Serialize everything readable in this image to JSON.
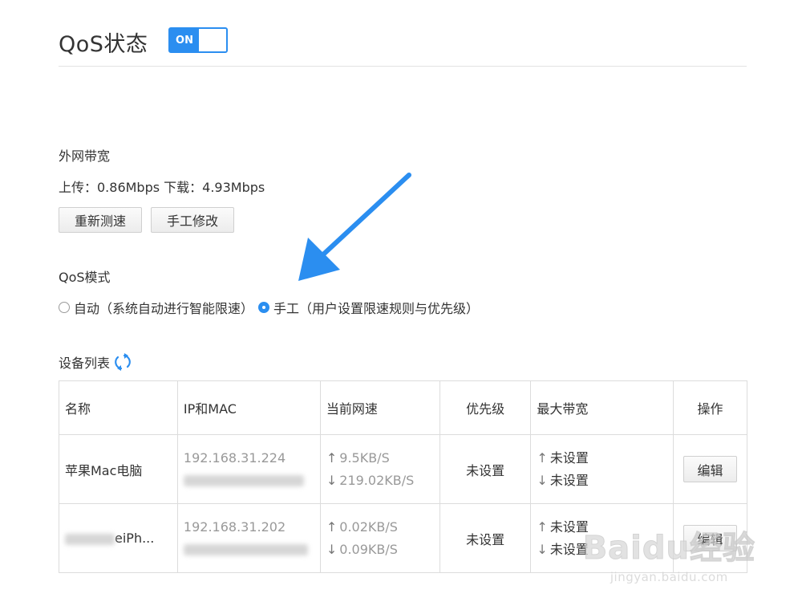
{
  "header": {
    "title": "QoS状态",
    "toggle_label": "ON",
    "toggle_state": "on"
  },
  "bandwidth": {
    "section_title": "外网带宽",
    "summary": "上传：0.86Mbps 下载：4.93Mbps",
    "retest_button": "重新测速",
    "manual_button": "手工修改"
  },
  "qos_mode": {
    "section_title": "QoS模式",
    "options": [
      {
        "label": "自动（系统自动进行智能限速）",
        "selected": false
      },
      {
        "label": "手工（用户设置限速规则与优先级）",
        "selected": true
      }
    ]
  },
  "device_list": {
    "section_title": "设备列表",
    "refresh_icon": "refresh-icon",
    "columns": [
      "名称",
      "IP和MAC",
      "当前网速",
      "优先级",
      "最大带宽",
      "操作"
    ],
    "rows": [
      {
        "name": "苹果Mac电脑",
        "ip": "192.168.31.224",
        "upload": "9.5KB/S",
        "download": "219.02KB/S",
        "priority": "未设置",
        "max_up": "未设置",
        "max_down": "未设置",
        "action": "编辑"
      },
      {
        "name": "eiPh...",
        "ip": "192.168.31.202",
        "upload": "0.02KB/S",
        "download": "0.09KB/S",
        "priority": "未设置",
        "max_up": "未设置",
        "max_down": "未设置",
        "action": "编辑"
      }
    ]
  },
  "watermark": {
    "main": "Baidu经验",
    "sub": "jingyan.baidu.com"
  },
  "colors": {
    "accent": "#2b8ef0",
    "text": "#333333",
    "muted": "#999999",
    "border": "#dcdcdc"
  }
}
